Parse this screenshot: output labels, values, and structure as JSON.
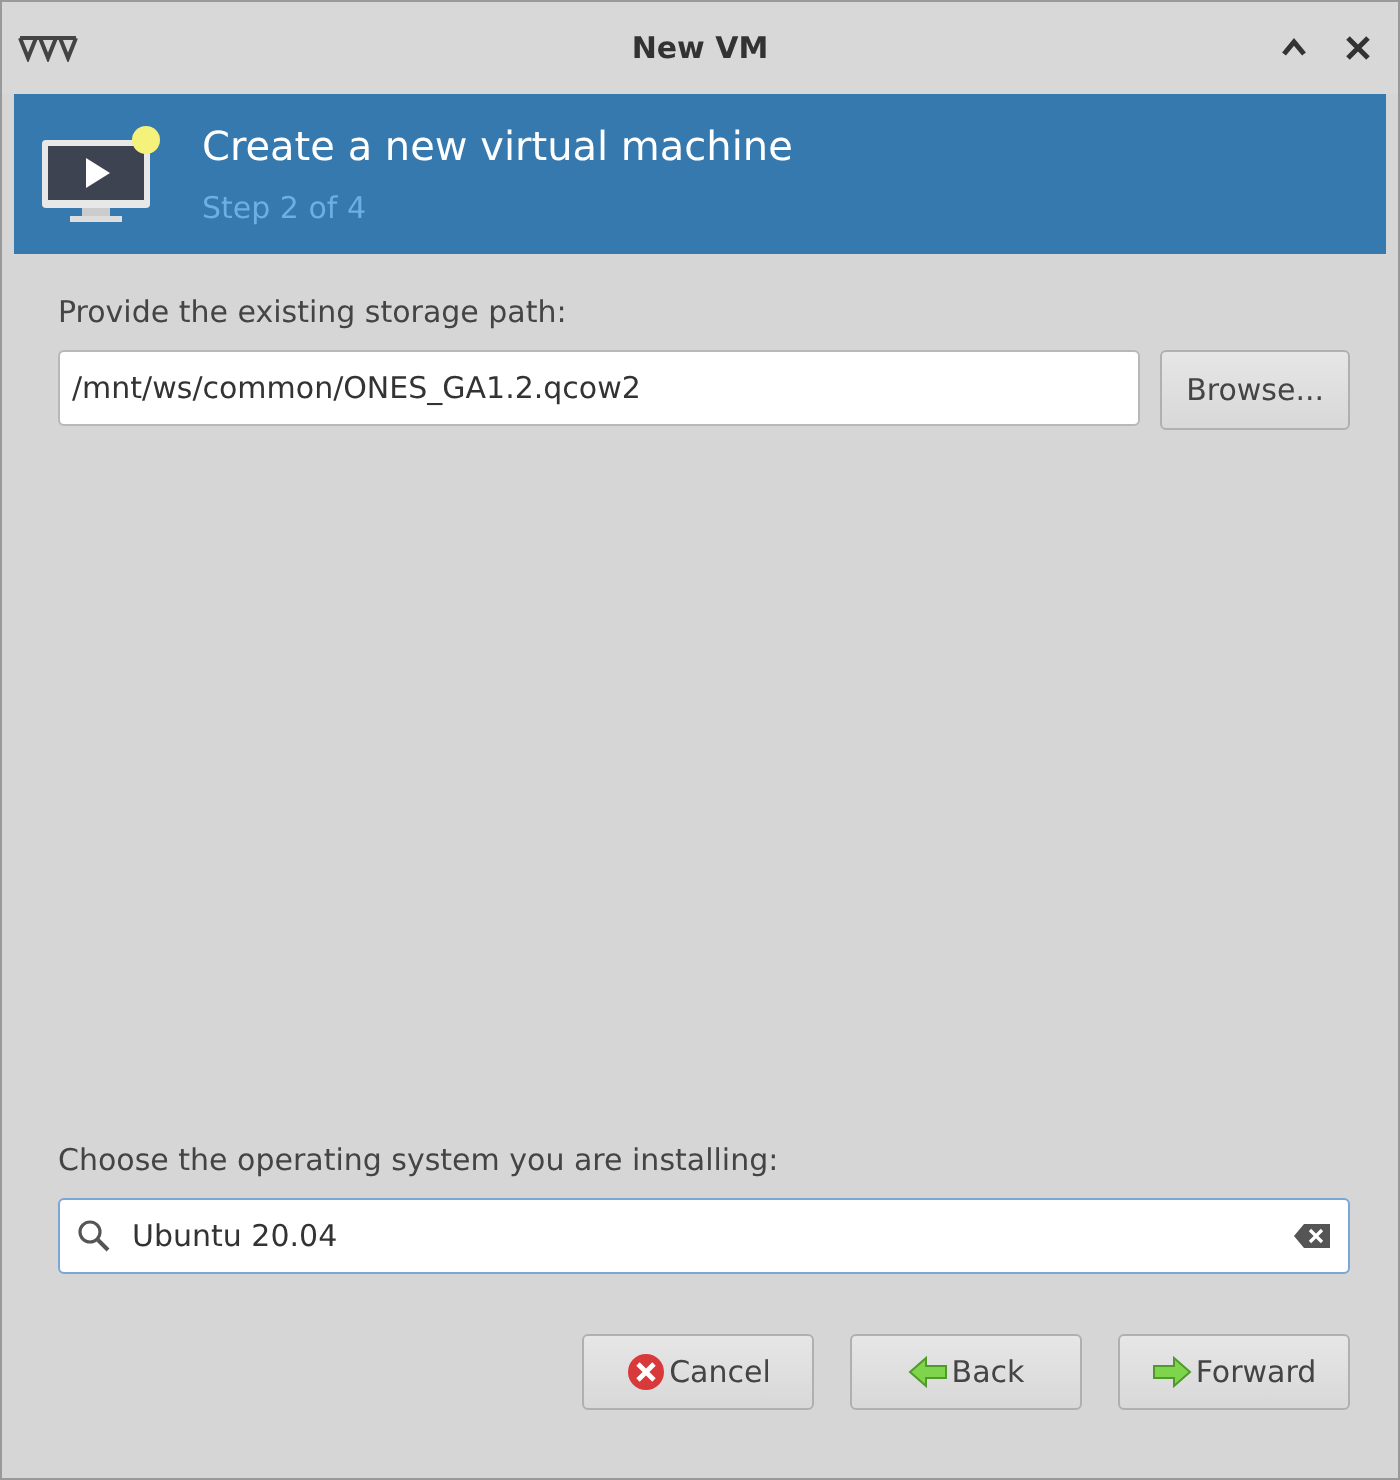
{
  "window": {
    "title": "New VM"
  },
  "header": {
    "title": "Create a new virtual machine",
    "subtitle": "Step 2 of 4"
  },
  "storage": {
    "label": "Provide the existing storage path:",
    "value": "/mnt/ws/common/ONES_GA1.2.qcow2",
    "browse_button": "Browse..."
  },
  "os": {
    "label": "Choose the operating system you are installing:",
    "value": "Ubuntu 20.04"
  },
  "buttons": [
    {
      "label": "Cancel",
      "kind": "cancel"
    },
    {
      "label": "Back",
      "kind": "back"
    },
    {
      "label": "Forward",
      "kind": "forward"
    }
  ]
}
